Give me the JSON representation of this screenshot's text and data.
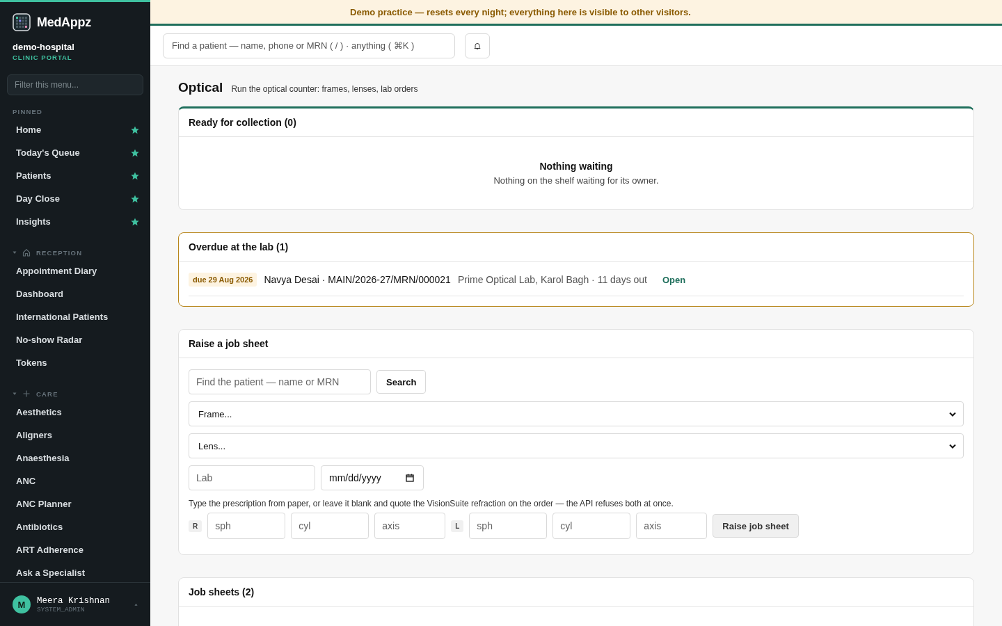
{
  "banner": "Demo practice — resets every night; everything here is visible to other visitors.",
  "sidebar": {
    "brand": "MedAppz",
    "org": "demo-hospital",
    "portal": "CLINIC PORTAL",
    "filter_placeholder": "Filter this menu...",
    "pinned": {
      "label": "PINNED",
      "items": [
        {
          "label": "Home",
          "starred": true
        },
        {
          "label": "Today's Queue",
          "starred": true
        },
        {
          "label": "Patients",
          "starred": true
        },
        {
          "label": "Day Close",
          "starred": true
        },
        {
          "label": "Insights",
          "starred": true
        }
      ]
    },
    "sections": [
      {
        "label": "RECEPTION",
        "kind": "front-desk",
        "expanded": true,
        "items": [
          "Appointment Diary",
          "Dashboard",
          "International Patients",
          "No-show Radar",
          "Tokens"
        ]
      },
      {
        "label": "CARE",
        "kind": "clinical",
        "expanded": true,
        "items": [
          "Aesthetics",
          "Aligners",
          "Anaesthesia",
          "ANC",
          "ANC Planner",
          "Antibiotics",
          "ART Adherence",
          "Ask a Specialist"
        ]
      }
    ],
    "user": {
      "initial": "M",
      "name": "Meera Krishnan",
      "role": "SYSTEM_ADMIN"
    }
  },
  "header": {
    "search_placeholder": "Find a patient — name, phone or MRN ( / ) · anything ( ⌘K )"
  },
  "page": {
    "title": "Optical",
    "subtitle": "Run the optical counter: frames, lenses, lab orders"
  },
  "ready": {
    "title": "Ready for collection (0)",
    "empty_title": "Nothing waiting",
    "empty_text": "Nothing on the shelf waiting for its owner."
  },
  "overdue": {
    "title": "Overdue at the lab (1)",
    "rows": [
      {
        "due": "due 29 Aug 2026",
        "patient": "Navya Desai · MAIN/2026-27/MRN/000021",
        "lab": "Prime Optical Lab, Karol Bagh · 11 days out",
        "action": "Open"
      }
    ]
  },
  "job_form": {
    "title": "Raise a job sheet",
    "patient_placeholder": "Find the patient — name or MRN",
    "search_button": "Search",
    "frame": "Frame...",
    "lens": "Lens...",
    "lab_placeholder": "Lab",
    "date_placeholder": "mm/dd/yyyy",
    "hint": "Type the prescription from paper, or leave it blank and quote the VisionSuite refraction on the order — the API refuses both at once.",
    "eyes": [
      {
        "label": "R",
        "fields": [
          {
            "placeholder": "sph"
          },
          {
            "placeholder": "cyl"
          },
          {
            "placeholder": "axis"
          }
        ]
      },
      {
        "label": "L",
        "fields": [
          {
            "placeholder": "sph"
          },
          {
            "placeholder": "cyl"
          },
          {
            "placeholder": "axis"
          }
        ]
      }
    ],
    "submit": "Raise job sheet"
  },
  "job_sheets": {
    "title": "Job sheets (2)"
  }
}
